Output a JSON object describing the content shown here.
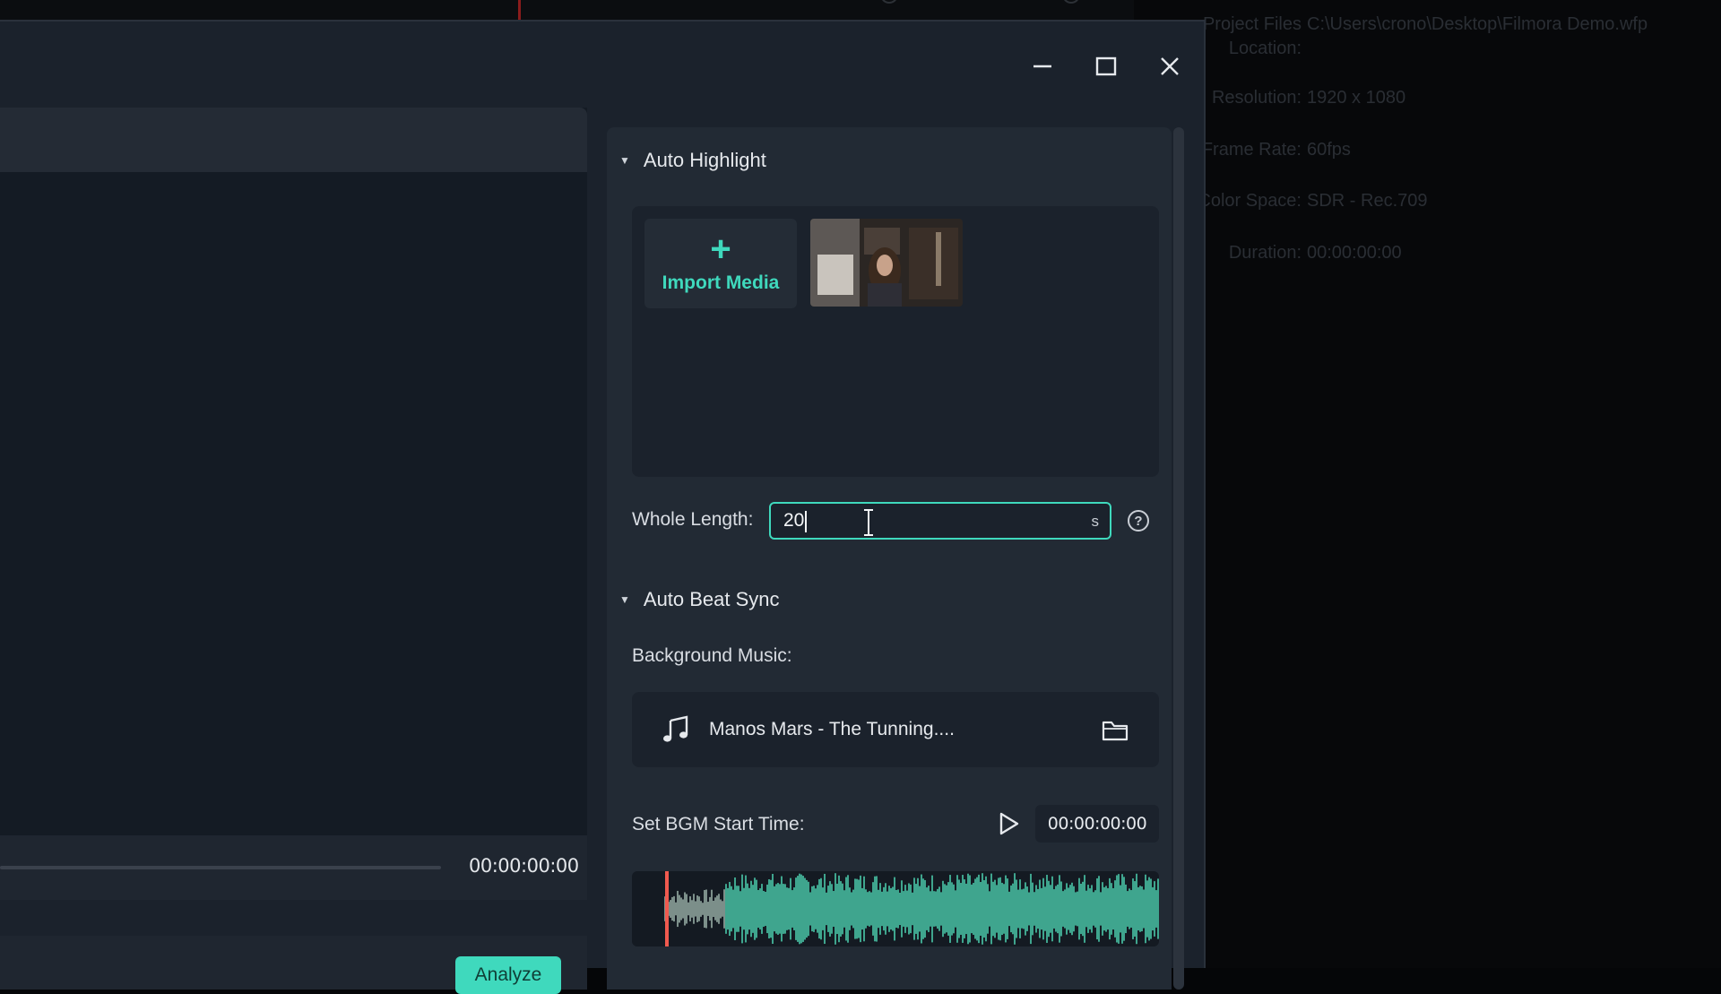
{
  "background_app": {
    "info": [
      {
        "label": "Project Files\nLocation:",
        "value": "C:\\Users\\crono\\Desktop\\Filmora Demo.wfp"
      },
      {
        "label": "Resolution:",
        "value": "1920 x 1080"
      },
      {
        "label": "Frame Rate:",
        "value": "60fps"
      },
      {
        "label": "Color Space:",
        "value": "SDR - Rec.709"
      },
      {
        "label": "Duration:",
        "value": "00:00:00:00"
      }
    ]
  },
  "window": {
    "minimize_icon": "minimize-icon",
    "maximize_icon": "maximize-icon",
    "close_icon": "close-icon"
  },
  "left_panel": {
    "time": "00:00:00:00",
    "analyze_label": "Analyze"
  },
  "auto_highlight": {
    "title": "Auto Highlight",
    "import_label": "Import Media",
    "whole_length_label": "Whole Length:",
    "whole_length_value": "20",
    "whole_length_unit": "s",
    "help_glyph": "?"
  },
  "auto_beat_sync": {
    "title": "Auto Beat Sync",
    "bgm_label": "Background Music:",
    "music_name": "Manos Mars - The Tunning....",
    "start_time_label": "Set BGM Start Time:",
    "start_time_value": "00:00:00:00"
  },
  "colors": {
    "accent": "#3fd9bd",
    "playhead": "#f05a4f",
    "waveform": "#3fa58e"
  }
}
